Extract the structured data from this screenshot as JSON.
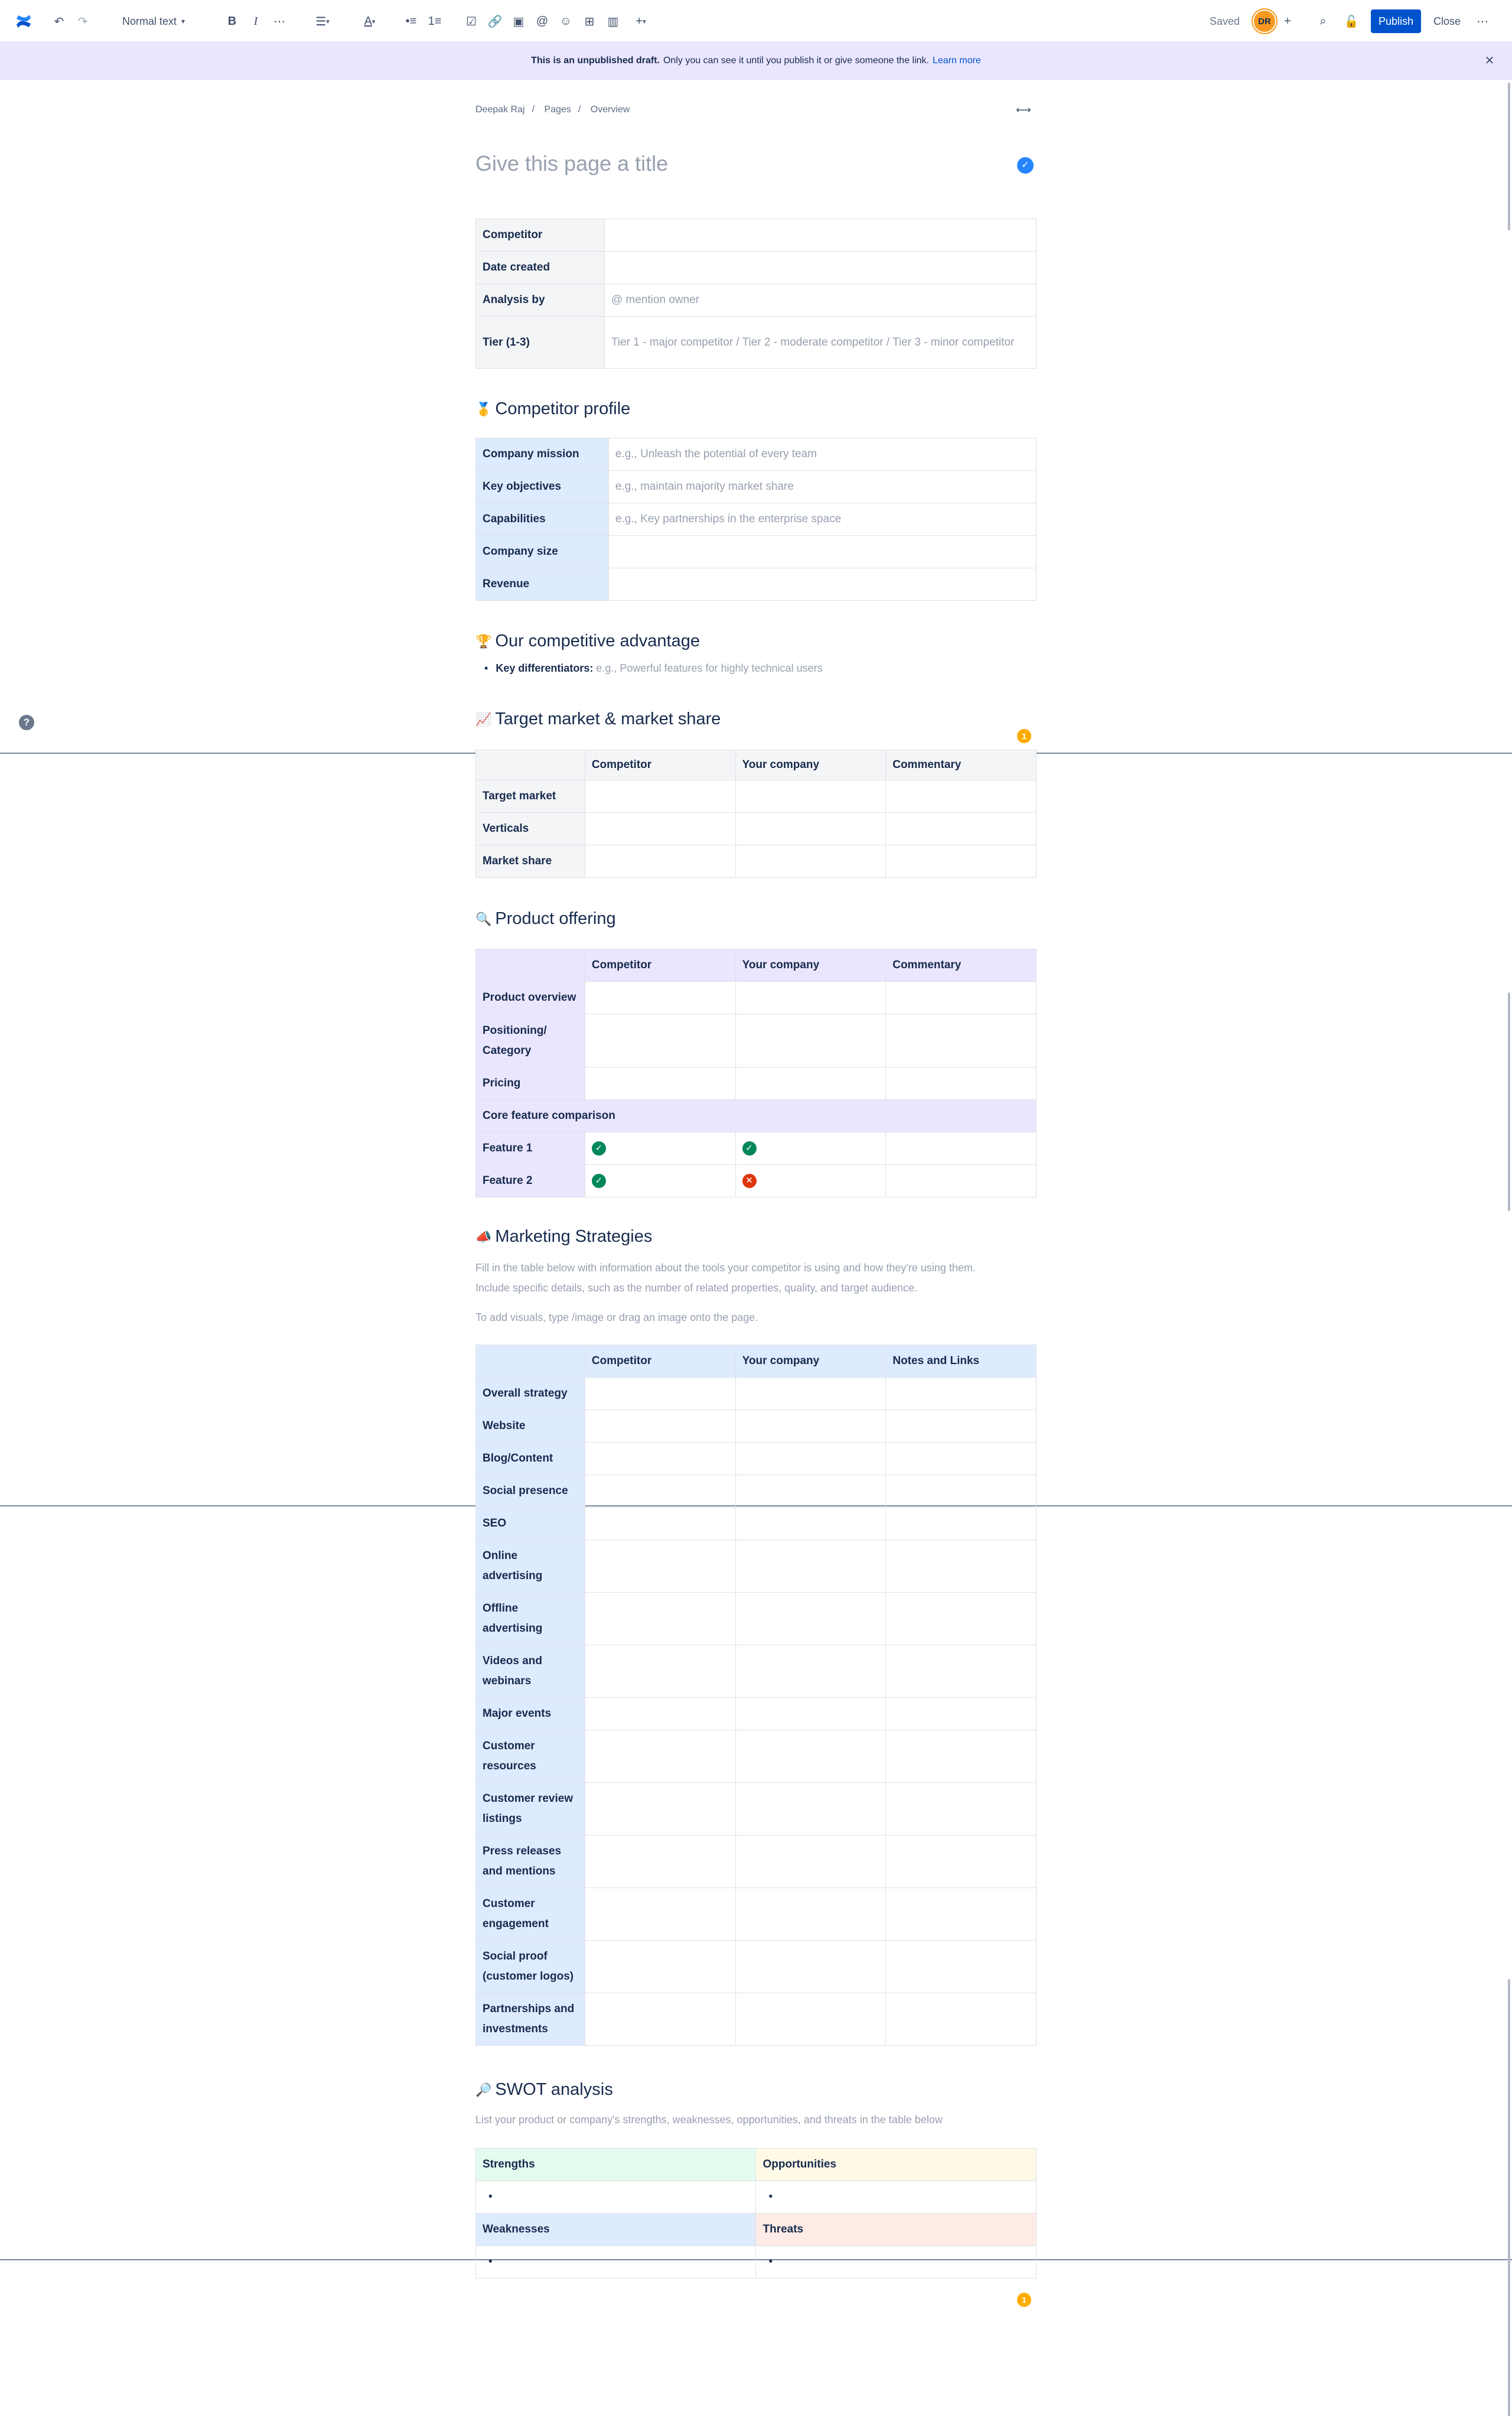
{
  "toolbar": {
    "text_style": "Normal text",
    "saved": "Saved",
    "avatar_initials": "DR",
    "publish": "Publish",
    "close": "Close"
  },
  "banner": {
    "bold": "This is an unpublished draft.",
    "text": "Only you can see it until you publish it or give someone the link.",
    "link": "Learn more"
  },
  "breadcrumb": [
    "Deepak Raj",
    "Pages",
    "Overview"
  ],
  "title_placeholder": "Give this page a title",
  "info_table": [
    {
      "label": "Competitor",
      "value": ""
    },
    {
      "label": "Date created",
      "value": ""
    },
    {
      "label": "Analysis by",
      "value": "@ mention owner"
    },
    {
      "label": "Tier (1-3)",
      "value": "Tier 1 - major competitor / Tier 2 - moderate competitor / Tier 3 - minor competitor"
    }
  ],
  "profile": {
    "heading": "Competitor profile",
    "rows": [
      {
        "label": "Company mission",
        "value": "e.g., Unleash the potential of every team"
      },
      {
        "label": "Key objectives",
        "value": "e.g., maintain majority market share"
      },
      {
        "label": "Capabilities",
        "value": "e.g., Key partnerships in the enterprise space"
      },
      {
        "label": "Company size",
        "value": ""
      },
      {
        "label": "Revenue",
        "value": ""
      }
    ]
  },
  "advantage": {
    "heading": "Our competitive advantage",
    "bullet_label": "Key differentiators:",
    "bullet_placeholder": "e.g., Powerful features for highly technical users"
  },
  "market": {
    "heading": "Target market & market share",
    "columns": [
      "Competitor",
      "Your company",
      "Commentary"
    ],
    "rows": [
      "Target market",
      "Verticals",
      "Market share"
    ]
  },
  "product": {
    "heading": "Product offering",
    "columns": [
      "Competitor",
      "Your company",
      "Commentary"
    ],
    "rows": [
      "Product overview",
      "Positioning/ Category",
      "Pricing"
    ],
    "section": "Core feature comparison",
    "features": [
      {
        "label": "Feature 1",
        "competitor": "yes",
        "you": "yes"
      },
      {
        "label": "Feature 2",
        "competitor": "yes",
        "you": "no"
      }
    ]
  },
  "marketing": {
    "heading": "Marketing Strategies",
    "intro1": "Fill in the table below with information about the tools your competitor is using and how they're using them.",
    "intro2": "Include specific details, such as the number of related properties, quality, and target audience.",
    "intro3": "To add visuals, type /image or drag an image onto the page.",
    "columns": [
      "Competitor",
      "Your company",
      "Notes and Links"
    ],
    "rows": [
      "Overall strategy",
      "Website",
      "Blog/Content",
      "Social presence",
      "SEO",
      "Online advertising",
      "Offline advertising",
      "Videos and webinars",
      "Major events",
      "Customer resources",
      "Customer review listings",
      "Press releases and mentions",
      "Customer engagement",
      "Social proof (customer logos)",
      "Partnerships and investments"
    ]
  },
  "swot": {
    "heading": "SWOT analysis",
    "intro": "List your product or company's strengths, weaknesses, opportunities, and threats in the table below",
    "strengths": "Strengths",
    "opportunities": "Opportunities",
    "weaknesses": "Weaknesses",
    "threats": "Threats"
  },
  "comment_count": "1",
  "colors": {
    "accent": "#0052cc",
    "banner": "#eae6ff",
    "header_gray": "#f4f5f7",
    "header_blue": "#deebff",
    "header_purple": "#eae6ff",
    "green": "#e3fcef",
    "yellow": "#fffae6",
    "red": "#ffebe6"
  }
}
